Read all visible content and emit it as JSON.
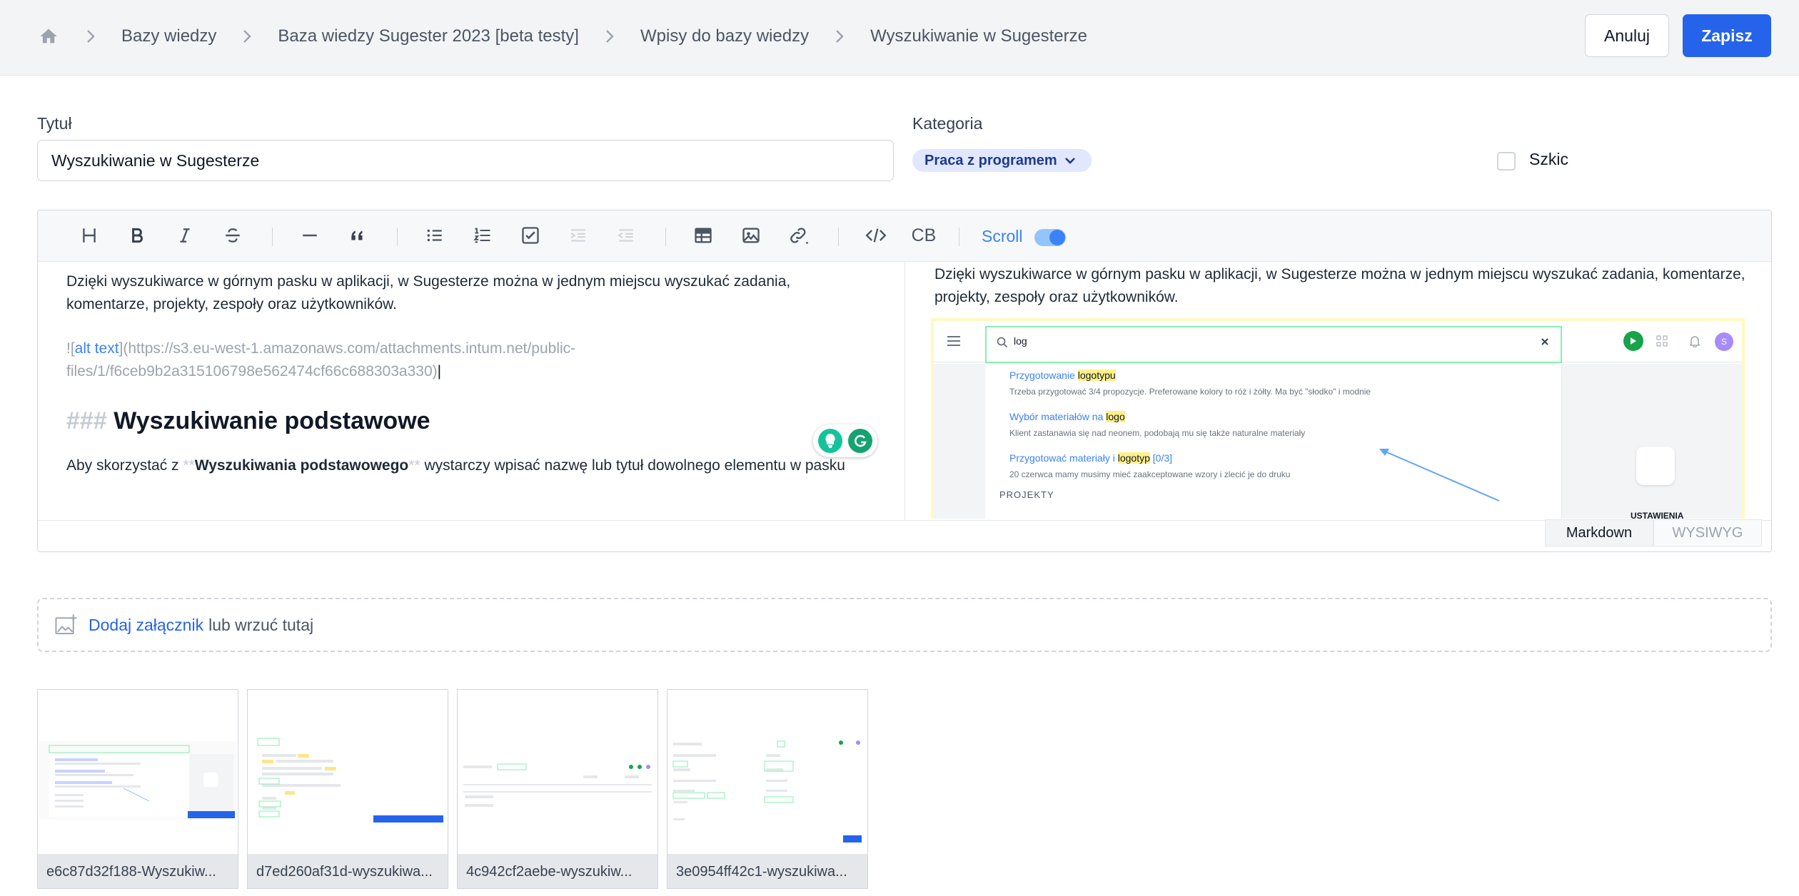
{
  "breadcrumb": {
    "home_icon": "home-icon",
    "items": [
      "Bazy wiedzy",
      "Baza wiedzy Sugester 2023 [beta testy]",
      "Wpisy do bazy wiedzy",
      "Wyszukiwanie w Sugesterze"
    ]
  },
  "actions": {
    "cancel_label": "Anuluj",
    "save_label": "Zapisz",
    "save_color": "#2563eb"
  },
  "form": {
    "title_label": "Tytuł",
    "title_value": "Wyszukiwanie w Sugesterze",
    "category_label": "Kategoria",
    "category_value": "Praca z programem",
    "draft_label": "Szkic",
    "draft_checked": false
  },
  "toolbar": {
    "buttons": [
      "heading-icon",
      "bold-icon",
      "italic-icon",
      "strikethrough-icon",
      "horizontal-rule-icon",
      "quote-icon",
      "bullet-list-icon",
      "numbered-list-icon",
      "task-list-icon",
      "indent-icon",
      "outdent-icon",
      "table-icon",
      "image-icon",
      "link-icon",
      "code-icon",
      "code-block-icon"
    ],
    "code_block_label": "CB",
    "scroll_label": "Scroll",
    "scroll_enabled": true
  },
  "markdown": {
    "intro": "Dzięki wyszukiwarce w górnym pasku w aplikacji, w Sugesterze można w jednym miejscu wyszukać zadania, komentarze, projekty, zespoły oraz użytkowników.",
    "image_prefix": "![",
    "image_alt": "alt text",
    "image_middle": "](",
    "image_url": "https://s3.eu-west-1.amazonaws.com/attachments.intum.net/public-files/1/f6ceb9b2a315106798e562474cf66c688303a330",
    "image_suffix": ")",
    "heading_hashes": "###",
    "heading_text": "Wyszukiwanie podstawowe",
    "para_start": "Aby skorzystać z ",
    "para_stars": "**",
    "para_bold": "Wyszukiwania podstawowego",
    "para_end": " wystarczy wpisać nazwę lub tytuł dowolnego elementu w pasku"
  },
  "preview": {
    "intro": "Dzięki wyszukiwarce w górnym pasku w aplikacji, w Sugesterze można w jednym miejscu wyszukać zadania, komentarze, projekty, zespoły oraz użytkowników.",
    "search_query": "log",
    "results": [
      {
        "title_pre": "Przygotowanie ",
        "title_hl": "logotypu",
        "title_post": "",
        "desc": "Trzeba przygotować 3/4 propozycje. Preferowane kolory to róż i żółty. Ma być \"słodko\" i modnie"
      },
      {
        "title_pre": "Wybór materiałów na ",
        "title_hl": "logo",
        "title_post": "",
        "desc": "Klient zastanawia się nad neonem, podobają mu się także naturalne materiały"
      },
      {
        "title_pre": "Przygotować materiały i ",
        "title_hl": "logotyp",
        "title_post": " [0/3]",
        "desc": "20 czerwca mamy musimy mieć zaakceptowane wzory i zlecić je do druku"
      }
    ],
    "section_label": "PROJEKTY",
    "side_label": "USTAWIENIA",
    "avatar_letter": "S"
  },
  "editor_tabs": {
    "markdown": "Markdown",
    "wysiwyg": "WYSIWYG"
  },
  "attachments": {
    "add_link": "Dodaj załącznik",
    "drop_text": "lub wrzuć tutaj",
    "files": [
      "e6c87d32f188-Wyszukiw...",
      "d7ed260af31d-wyszukiwa...",
      "4c942cf2aebe-wyszukiw...",
      "3e0954ff42c1-wyszukiwa..."
    ]
  }
}
